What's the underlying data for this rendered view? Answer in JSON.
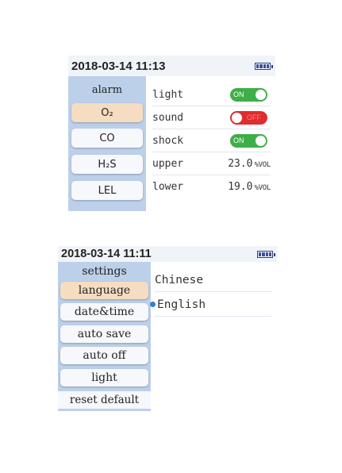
{
  "alarm_screen": {
    "status": {
      "datetime": "2018-03-14 11:13",
      "battery_icon": "battery-full-icon",
      "battery_level": 1.0
    },
    "sidebar": {
      "title": "alarm",
      "items": [
        {
          "label": "O₂",
          "active": true
        },
        {
          "label": "CO",
          "active": false
        },
        {
          "label": "H₂S",
          "active": false
        },
        {
          "label": "LEL",
          "active": false
        }
      ]
    },
    "rows": {
      "light": {
        "label": "light",
        "toggle": "ON",
        "state": true
      },
      "sound": {
        "label": "sound",
        "toggle": "OFF",
        "state": false
      },
      "shock": {
        "label": "shock",
        "toggle": "ON",
        "state": true
      },
      "upper": {
        "label": "upper",
        "value": "23.0",
        "unit": "%VOL"
      },
      "lower": {
        "label": "lower",
        "value": "19.0",
        "unit": "%VOL"
      }
    },
    "colors": {
      "toggle_on": "#3fae49",
      "toggle_off": "#de2d2d",
      "active_item": "#f6dcc0",
      "sidebar": "#bcd0ea"
    }
  },
  "settings_screen": {
    "status": {
      "datetime": "2018-03-14 11:11",
      "battery_icon": "battery-full-icon",
      "battery_level": 1.0
    },
    "sidebar": {
      "title": "settings",
      "items": [
        {
          "label": "language",
          "active": true
        },
        {
          "label": "date&time",
          "active": false
        },
        {
          "label": "auto save",
          "active": false
        },
        {
          "label": "auto off",
          "active": false
        },
        {
          "label": "light",
          "active": false
        },
        {
          "label": "reset default",
          "active": false
        }
      ]
    },
    "languages": [
      {
        "label": "Chinese",
        "selected": false
      },
      {
        "label": "English",
        "selected": true
      }
    ],
    "colors": {
      "selected_dot": "#2f7fd6"
    }
  }
}
